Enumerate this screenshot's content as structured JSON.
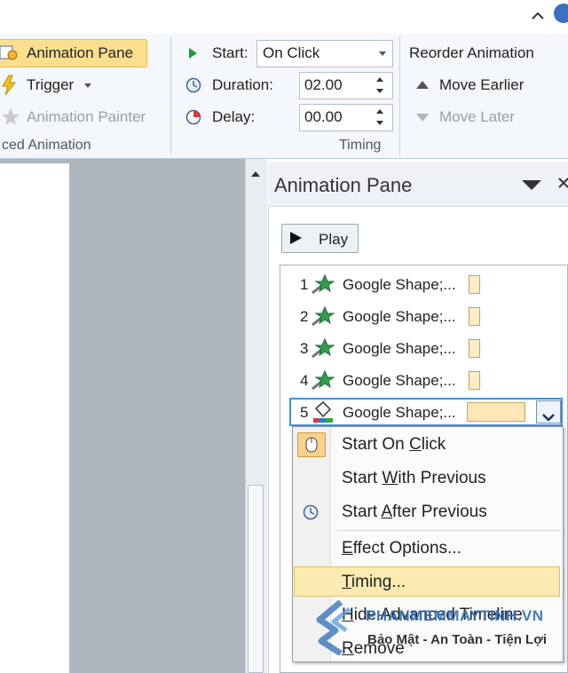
{
  "ribbon": {
    "animation_pane_label": "Animation Pane",
    "trigger_label": "Trigger",
    "animation_painter_label": "Animation Painter",
    "advanced_animation_group": "ced Animation",
    "start_label": "Start:",
    "start_value": "On Click",
    "duration_label": "Duration:",
    "duration_value": "02.00",
    "delay_label": "Delay:",
    "delay_value": "00.00",
    "timing_group": "Timing",
    "reorder_title": "Reorder Animation",
    "move_earlier_label": "Move Earlier",
    "move_later_label": "Move Later"
  },
  "pane": {
    "title": "Animation Pane",
    "play_label": "Play",
    "items": [
      {
        "num": "1",
        "label": "Google Shape;..."
      },
      {
        "num": "2",
        "label": "Google Shape;..."
      },
      {
        "num": "3",
        "label": "Google Shape;..."
      },
      {
        "num": "4",
        "label": "Google Shape;..."
      },
      {
        "num": "5",
        "label": "Google Shape;..."
      }
    ]
  },
  "context_menu": {
    "start_on_click": {
      "pre": "Start On ",
      "key": "C",
      "post": "lick"
    },
    "start_with_previous": {
      "pre": "Start ",
      "key": "W",
      "post": "ith Previous"
    },
    "start_after_previous": {
      "pre": "Start ",
      "key": "A",
      "post": "fter Previous"
    },
    "effect_options": {
      "pre": "",
      "key": "E",
      "post": "ffect Options..."
    },
    "timing": {
      "pre": "",
      "key": "T",
      "post": "iming..."
    },
    "hide_advanced_timeline": {
      "pre": "",
      "key": "H",
      "post": "ide Advanced Timeline"
    },
    "remove": {
      "pre": "",
      "key": "R",
      "post": "emove"
    }
  },
  "watermark": {
    "brand": "PHANMEMMAYTINH.VN",
    "tagline": "Bảo Mật - An Toàn - Tiện Lợi"
  },
  "colors": {
    "highlight": "#fcdf8e",
    "selection_border": "#3f8fe0",
    "timeline_bar": "#fdecc4",
    "watermark_blue": "#2d6fb6"
  }
}
